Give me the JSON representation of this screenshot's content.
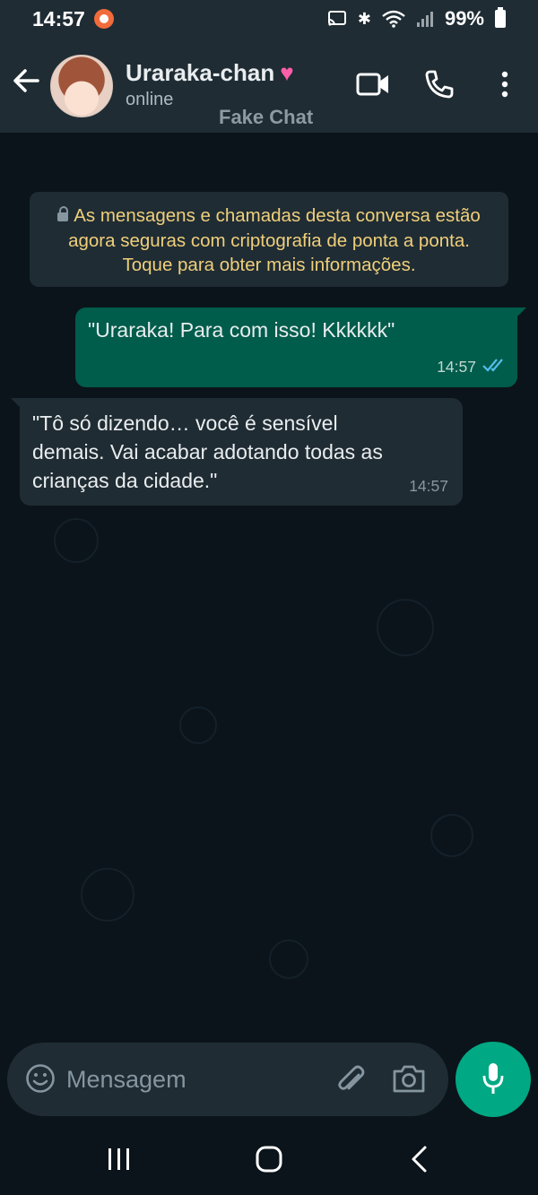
{
  "status_bar": {
    "time": "14:57",
    "battery": "99%"
  },
  "header": {
    "contact_name": "Uraraka-chan",
    "presence": "online",
    "watermark": "Fake Chat"
  },
  "chat": {
    "encryption_notice": "As mensagens e chamadas desta conversa estão agora seguras com criptografia de ponta a ponta. Toque para obter mais informações.",
    "messages": [
      {
        "direction": "outgoing",
        "text": "\"Uraraka! Para com isso! Kkkkkk\"",
        "time": "14:57",
        "status": "read"
      },
      {
        "direction": "incoming",
        "text": "\"Tô só dizendo… você é sensível demais. Vai acabar adotando todas as crianças da cidade.\"",
        "time": "14:57"
      }
    ]
  },
  "composer": {
    "placeholder": "Mensagem"
  },
  "icons": {
    "back": "arrow-left-icon",
    "video": "video-camera-icon",
    "call": "phone-icon",
    "menu": "more-vertical-icon",
    "emoji": "emoji-icon",
    "attach": "paperclip-icon",
    "camera": "camera-icon",
    "mic": "microphone-icon"
  },
  "colors": {
    "header_bg": "#1f2c34",
    "chat_bg": "#0b141a",
    "outgoing_bubble": "#005c4b",
    "incoming_bubble": "#202c33",
    "accent": "#00a884",
    "notice_text": "#f0cf7a",
    "read_ticks": "#53bdeb"
  }
}
